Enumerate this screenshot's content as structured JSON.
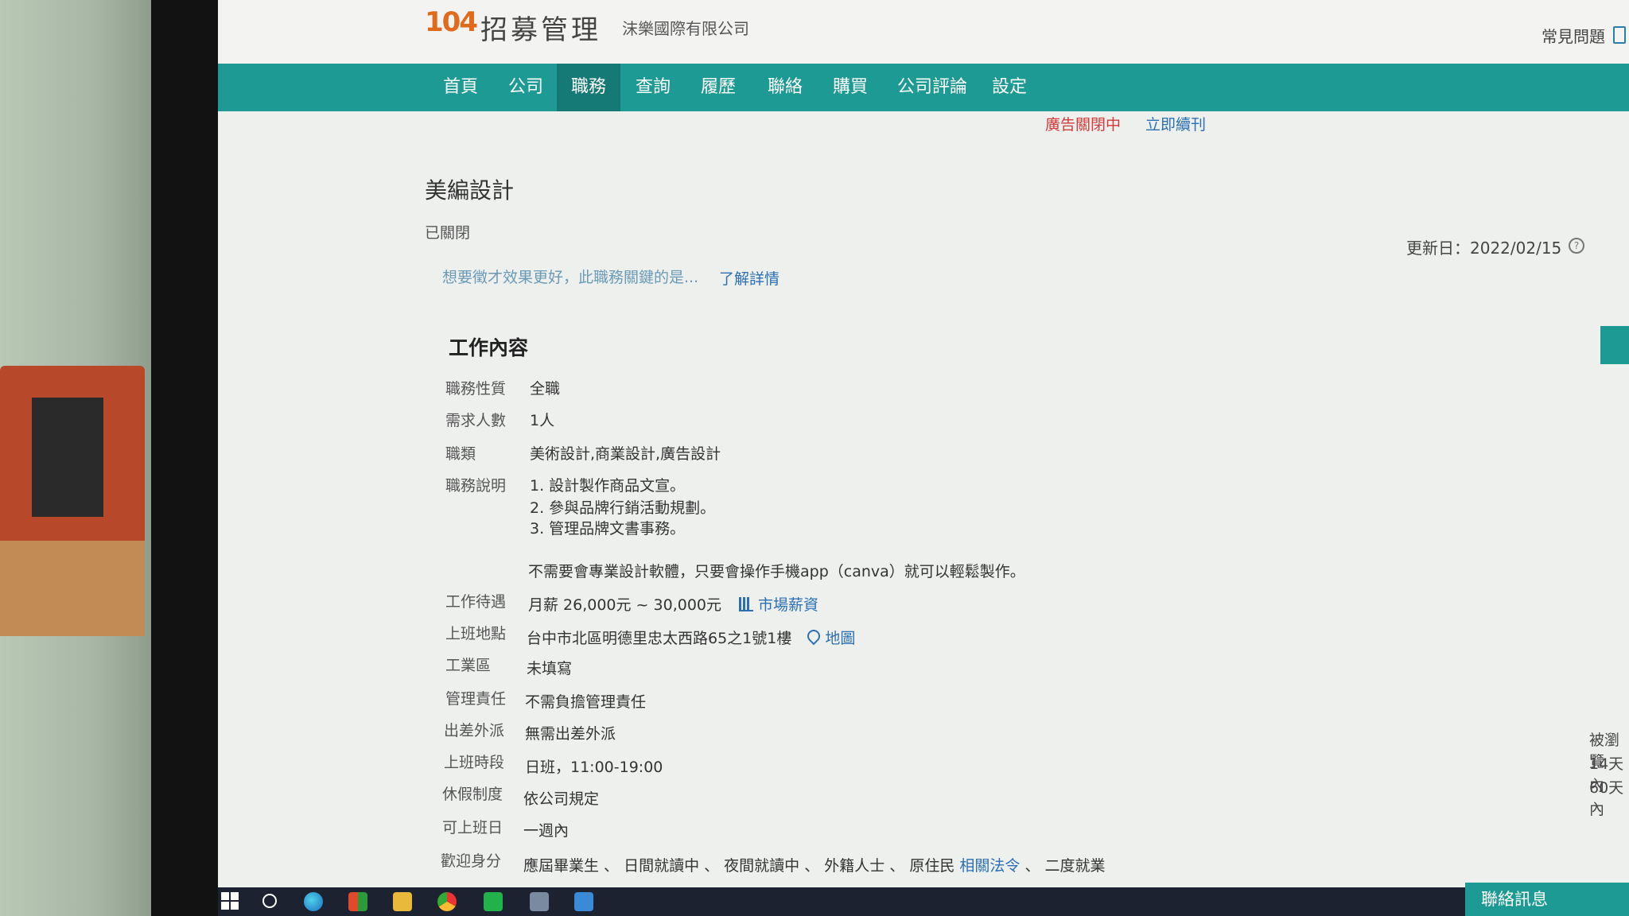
{
  "brand": {
    "logo": "104",
    "title": "招募管理",
    "company": "沫樂國際有限公司"
  },
  "header": {
    "faq": "常見問題"
  },
  "nav": {
    "items": [
      "首頁",
      "公司",
      "職務",
      "查詢",
      "履歷",
      "聯絡",
      "購買",
      "公司評論",
      "設定"
    ],
    "active": "職務"
  },
  "notice": {
    "ad_status": "廣告關閉中",
    "renew": "立即續刊"
  },
  "job": {
    "title": "美編設計",
    "status": "已關閉",
    "updated": "更新日：2022/02/15",
    "promo_text": "想要徵才效果更好，此職務關鍵的是...",
    "promo_link": "了解詳情"
  },
  "section": {
    "title": "工作內容"
  },
  "rows": [
    {
      "label": "職務性質",
      "value": "全職"
    },
    {
      "label": "需求人數",
      "value": "1人"
    },
    {
      "label": "職類",
      "value": "美術設計,商業設計,廣告設計"
    },
    {
      "label": "職務說明",
      "lines": [
        "1. 設計製作商品文宣。",
        "2. 參與品牌行銷活動規劃。",
        "3. 管理品牌文書事務。",
        "",
        "不需要會專業設計軟體，只要會操作手機app（canva）就可以輕鬆製作。"
      ]
    },
    {
      "label": "工作待遇",
      "value": "月薪 26,000元 ~ 30,000元",
      "link": "市場薪資"
    },
    {
      "label": "上班地點",
      "value": "台中市北區明德里忠太西路65之1號1樓",
      "link": "地圖"
    },
    {
      "label": "工業區",
      "value": "未填寫"
    },
    {
      "label": "管理責任",
      "value": "不需負擔管理責任"
    },
    {
      "label": "出差外派",
      "value": "無需出差外派"
    },
    {
      "label": "上班時段",
      "value": "日班，11:00-19:00"
    },
    {
      "label": "休假制度",
      "value": "依公司規定"
    },
    {
      "label": "可上班日",
      "value": "一週內"
    },
    {
      "label": "歡迎身分",
      "value": "應屆畢業生 、 日間就讀中 、 夜間就讀中 、 外籍人士 、 原住民",
      "link": "相關法令",
      "suffix": "、 二度就業"
    }
  ],
  "side": {
    "stats": [
      "被瀏覽",
      "14天內",
      "60天內"
    ]
  },
  "contact": {
    "label": "聯絡訊息"
  },
  "taskbar": {
    "icons": [
      "windows-start-icon",
      "search-icon",
      "edge-icon",
      "store-icon",
      "file-explorer-icon",
      "chrome-icon",
      "line-icon",
      "app-icon",
      "photos-icon"
    ]
  },
  "colors": {
    "nav": "#1e9a94",
    "nav_active": "#157a75",
    "link": "#2b6fb5",
    "alert": "#d23a3a",
    "logo": "#e06b1d"
  }
}
